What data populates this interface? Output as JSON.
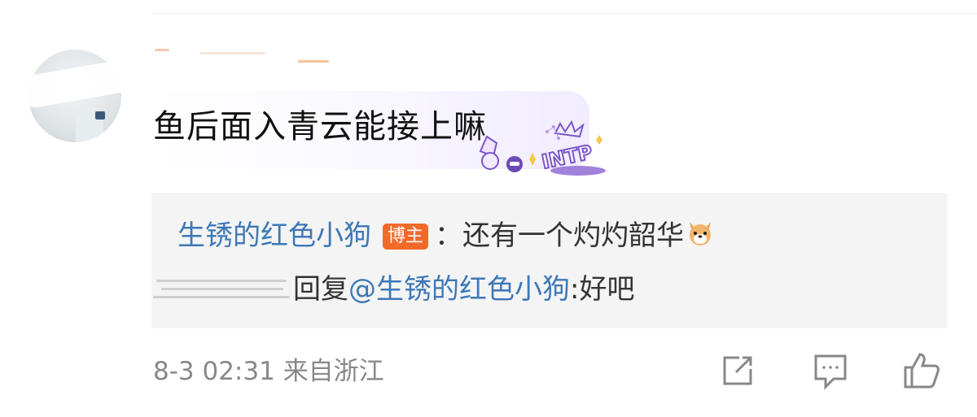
{
  "comment": {
    "text": "鱼后面入青云能接上嘛"
  },
  "reply": {
    "author": "生锈的红色小狗",
    "author_badge": "博主",
    "text": "：还有一个灼灼韶华",
    "reply_prefix": "回复",
    "mention": "@生锈的红色小狗",
    "reply_text": ":好吧"
  },
  "footer": {
    "timestamp": "8-3 02:31",
    "location": "来自浙江"
  },
  "decoration": {
    "tag": "INTP"
  },
  "colors": {
    "link": "#3d78b8",
    "badge": "#f26a2a",
    "reply_bg": "#f4f4f4",
    "meta_text": "#888888"
  },
  "icons": [
    "share-icon",
    "comment-icon",
    "like-icon",
    "dog-emoji-icon"
  ]
}
